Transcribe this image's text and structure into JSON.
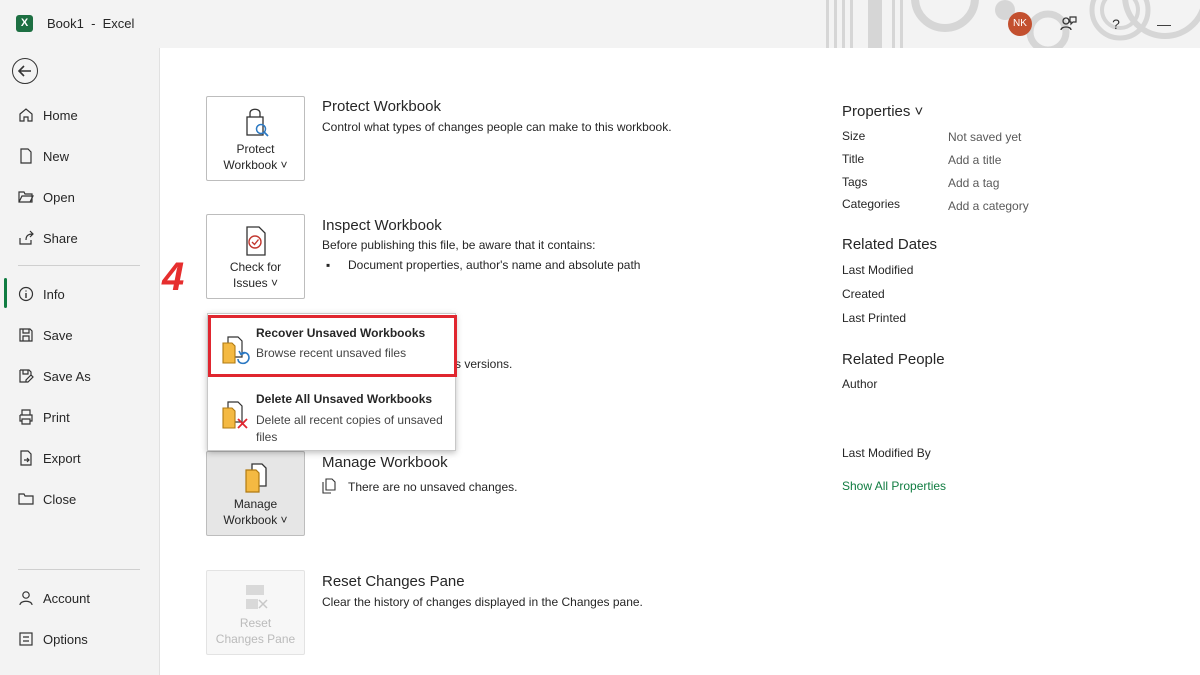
{
  "titlebar": {
    "app_icon_letter": "X",
    "title": "Book1  -  Excel",
    "avatar_initials": "NK",
    "help": "?",
    "minimize": "—"
  },
  "sidebar": {
    "items": [
      {
        "label": "Home"
      },
      {
        "label": "New"
      },
      {
        "label": "Open"
      },
      {
        "label": "Share"
      },
      {
        "label": "Info"
      },
      {
        "label": "Save"
      },
      {
        "label": "Save As"
      },
      {
        "label": "Print"
      },
      {
        "label": "Export"
      },
      {
        "label": "Close"
      }
    ],
    "bottom_items": [
      {
        "label": "Account"
      },
      {
        "label": "Options"
      }
    ]
  },
  "sections": {
    "protect": {
      "tile_line1": "Protect",
      "tile_line2": "Workbook ˅",
      "title": "Protect Workbook",
      "desc": "Control what types of changes people can make to this workbook."
    },
    "inspect": {
      "tile_line1": "Check for",
      "tile_line2": "Issues ˅",
      "title": "Inspect Workbook",
      "desc": "Before publishing this file, be aware that it contains:",
      "bullet": "Document properties, author's name and absolute path"
    },
    "versions": {
      "partial_desc": "s versions."
    },
    "manage": {
      "tile_line1": "Manage",
      "tile_line2": "Workbook ˅",
      "title": "Manage Workbook",
      "desc": "There are no unsaved changes."
    },
    "reset": {
      "tile_line1": "Reset",
      "tile_line2": "Changes Pane",
      "title": "Reset Changes Pane",
      "desc": "Clear the history of changes displayed in the Changes pane."
    }
  },
  "step_marker": "4",
  "dropdown": {
    "items": [
      {
        "title": "Recover Unsaved Workbooks",
        "subtitle": "Browse recent unsaved files"
      },
      {
        "title": "Delete All Unsaved Workbooks",
        "subtitle": "Delete all recent copies of unsaved files"
      }
    ]
  },
  "properties": {
    "heading": "Properties ˅",
    "rows": [
      {
        "label": "Size",
        "value": "Not saved yet"
      },
      {
        "label": "Title",
        "value": "Add a title"
      },
      {
        "label": "Tags",
        "value": "Add a tag"
      },
      {
        "label": "Categories",
        "value": "Add a category"
      }
    ],
    "related_dates": {
      "heading": "Related Dates",
      "rows": [
        "Last Modified",
        "Created",
        "Last Printed"
      ]
    },
    "related_people": {
      "heading": "Related People",
      "author_label": "Author",
      "last_modified_by_label": "Last Modified By"
    },
    "show_all_link": "Show All Properties"
  },
  "colors": {
    "accent_green": "#107c41",
    "highlight_red": "#e0262f",
    "avatar_bg": "#c3502f"
  }
}
